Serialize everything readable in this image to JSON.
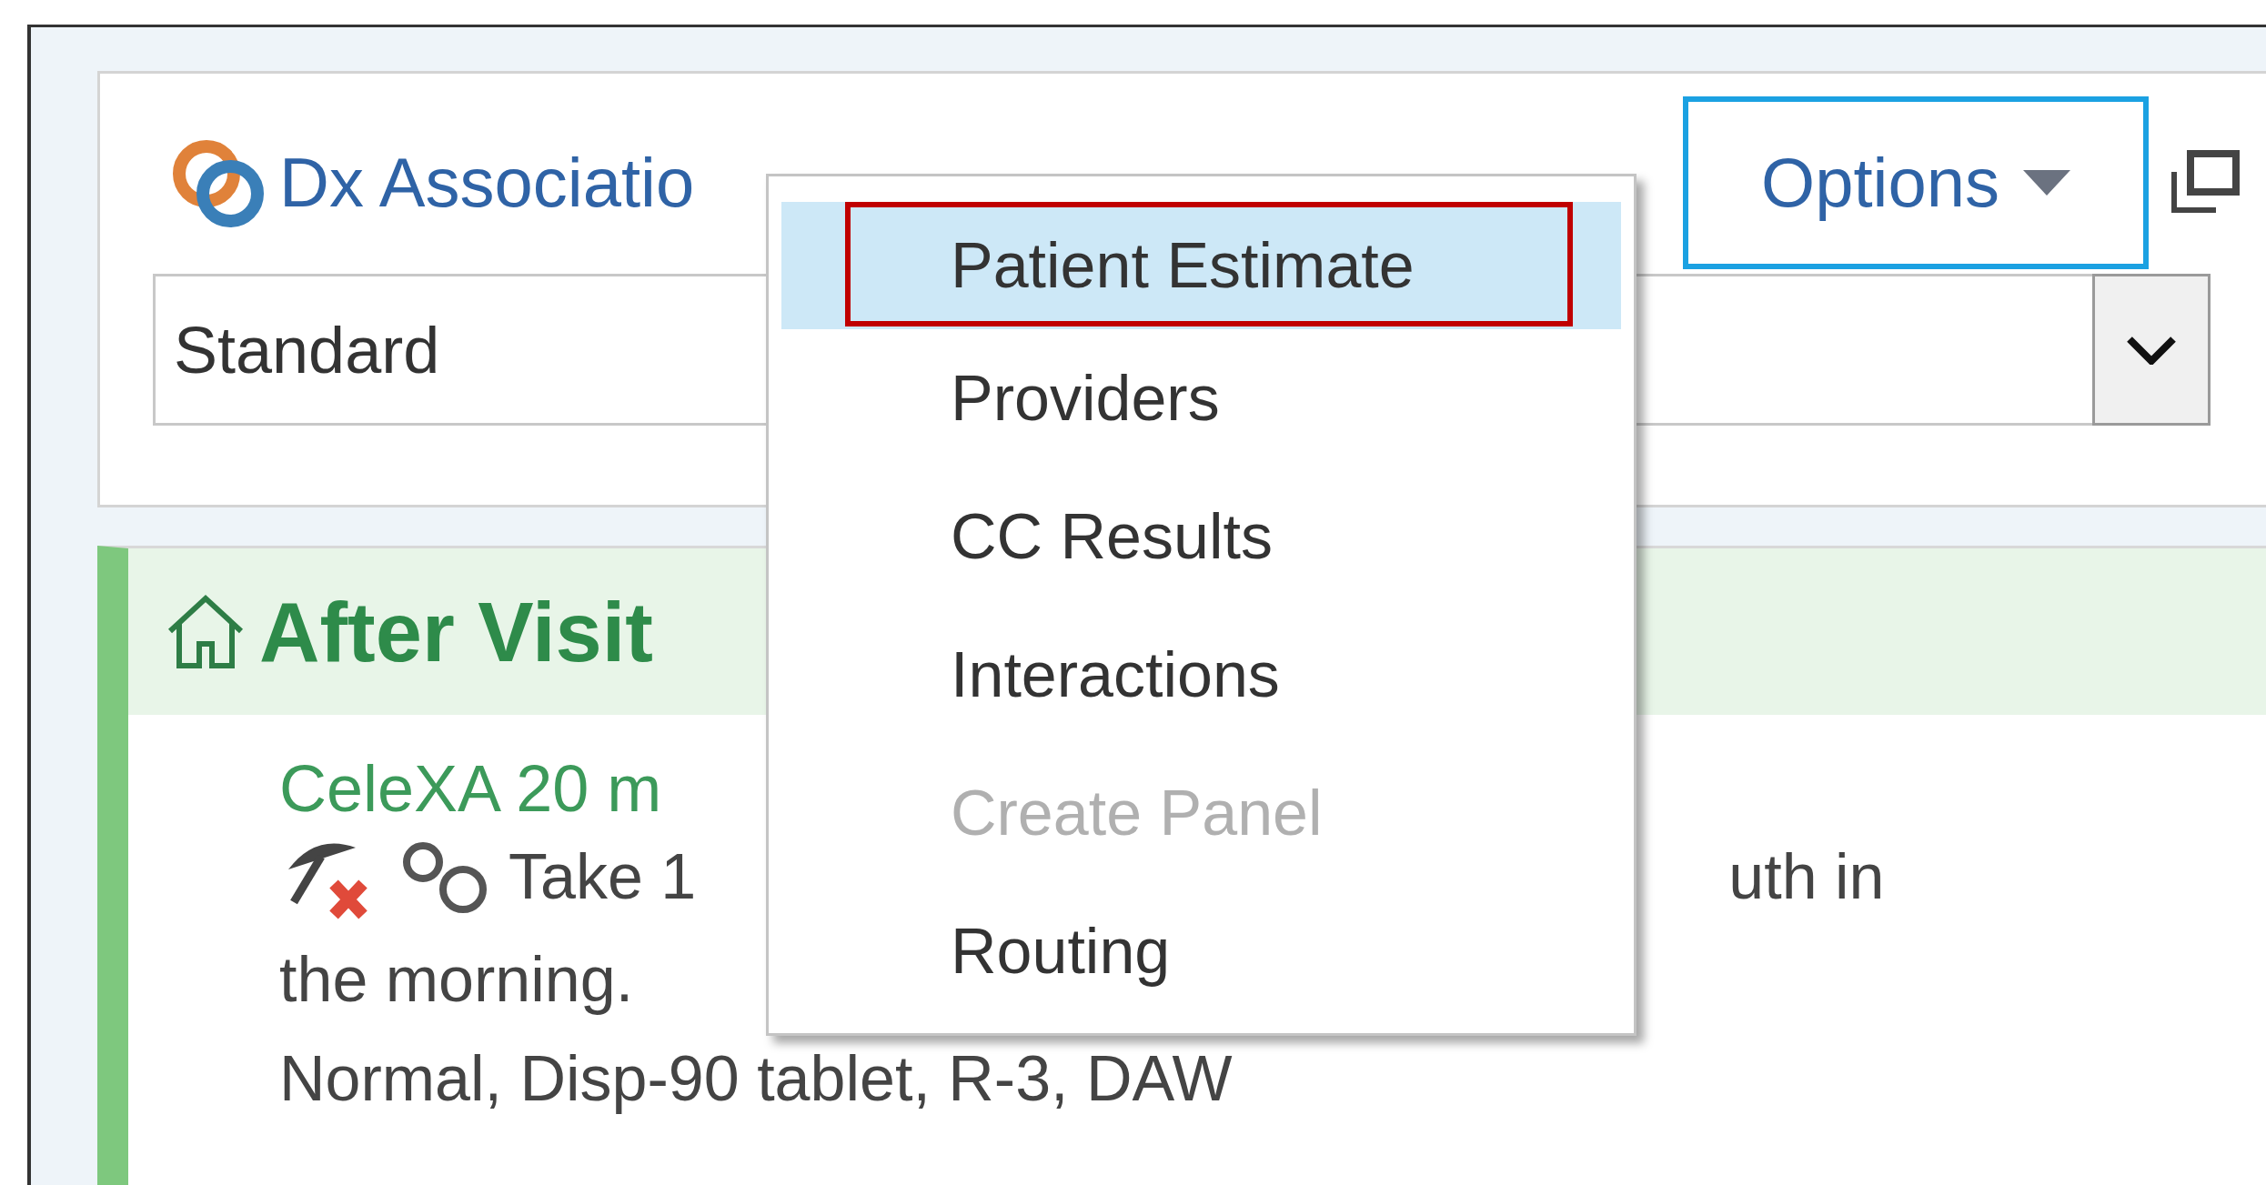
{
  "header": {
    "dx_link": "Dx Associatio",
    "options_button": {
      "label": "Options",
      "focused": true
    }
  },
  "order_mode": {
    "value": "Standard"
  },
  "menu": {
    "items": [
      {
        "label": "Patient Estimate",
        "selected": true,
        "disabled": false,
        "outlined": true
      },
      {
        "label": "Providers",
        "selected": false,
        "disabled": false,
        "outlined": false
      },
      {
        "label": "CC Results",
        "selected": false,
        "disabled": false,
        "outlined": false
      },
      {
        "label": "Interactions",
        "selected": false,
        "disabled": false,
        "outlined": false
      },
      {
        "label": "Create Panel",
        "selected": false,
        "disabled": true,
        "outlined": false
      },
      {
        "label": "Routing",
        "selected": false,
        "disabled": false,
        "outlined": false
      }
    ]
  },
  "section": {
    "title": "After Visit",
    "medication": {
      "name": "CeleXA 20 m",
      "sig_start": "Take 1",
      "sig_end": "uth in",
      "sig_line2": "the morning.",
      "details": "Normal, Disp-90 tablet, R-3, DAW"
    }
  }
}
